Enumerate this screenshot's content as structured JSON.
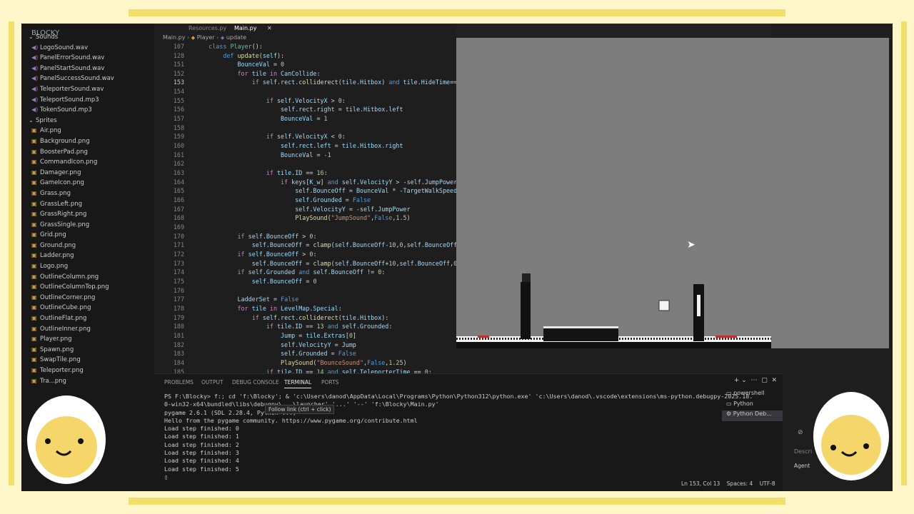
{
  "editor": {
    "tabs": [
      "Resources.py",
      "Main.py"
    ],
    "breadcrumb": [
      "Main.py",
      "Player",
      "update"
    ],
    "current_line": 153
  },
  "explorer": {
    "header": "BLOCKY",
    "folders": [
      {
        "name": "Sounds",
        "files": [
          "LogoSound.wav",
          "PanelErrorSound.wav",
          "PanelStartSound.wav",
          "PanelSuccessSound.wav",
          "TeleporterSound.wav",
          "TeleportSound.mp3",
          "TokenSound.mp3"
        ]
      },
      {
        "name": "Sprites",
        "files": [
          "Air.png",
          "Background.png",
          "BoosterPad.png",
          "CommandIcon.png",
          "Damager.png",
          "GameIcon.png",
          "Grass.png",
          "GrassLeft.png",
          "GrassRight.png",
          "GrassSingle.png",
          "Grid.png",
          "Ground.png",
          "Ladder.png",
          "Logo.png",
          "OutlineColumn.png",
          "OutlineColumnTop.png",
          "OutlineCorner.png",
          "OutlineCube.png",
          "OutlineFlat.png",
          "OutlineInner.png",
          "Player.png",
          "Spawn.png",
          "SwapTile.png",
          "Teleporter.png",
          "Tra...png"
        ]
      }
    ]
  },
  "panel": {
    "tabs": [
      "PROBLEMS",
      "OUTPUT",
      "DEBUG CONSOLE",
      "TERMINAL",
      "PORTS"
    ],
    "active_tab": "TERMINAL",
    "terminal_lines": [
      "PS F:\\Blocky> f:; cd 'f:\\Blocky'; & 'c:\\Users\\danod\\AppData\\Local\\Programs\\Python\\Python312\\python.exe' 'c:\\Users\\danod\\.vscode\\extensions\\ms-python.debugpy-2025.18.",
      "0-win32-x64\\bundled\\libs\\debugpy\\...\\launcher' '...' '--' 'f:\\Blocky\\Main.py'",
      "pygame 2.6.1 (SDL 2.28.4, Python ...)",
      "Hello from the pygame community. https://www.pygame.org/contribute.html",
      "Load step finished: 0",
      "Load step finished: 1",
      "Load step finished: 2",
      "Load step finished: 3",
      "Load step finished: 4",
      "Load step finished: 5"
    ],
    "tooltip": "Follow link (ctrl + click)",
    "terminals": [
      "powershell",
      "Python",
      "Python Deb..."
    ]
  },
  "status": {
    "position": "Ln 153, Col 13",
    "spaces": "Spaces: 4",
    "encoding": "UTF-8"
  },
  "chat": {
    "description": "Descri",
    "agent": "Agent"
  }
}
